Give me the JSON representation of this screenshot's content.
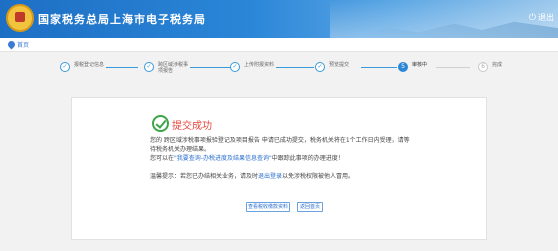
{
  "header": {
    "title": "国家税务总局上海市电子税务局",
    "logout_label": "退出"
  },
  "breadcrumb": {
    "home_label": "首页"
  },
  "steps": [
    {
      "index": "✓",
      "label": "报税登记信息",
      "state": "done"
    },
    {
      "index": "✓",
      "label": "跨区域涉税事项报告",
      "state": "done"
    },
    {
      "index": "✓",
      "label": "上传附报资料",
      "state": "done"
    },
    {
      "index": "✓",
      "label": "预览提交",
      "state": "done"
    },
    {
      "index": "5",
      "label": "审核中",
      "state": "current"
    },
    {
      "index": "6",
      "label": "完成",
      "state": "todo"
    }
  ],
  "result": {
    "title": "提交成功",
    "msg1_prefix": "您的 跨区域涉税事项报验登记及项目报告 申请已成功提交，税务机关将在1个工作日内受理，请等待税务机关办理结果。",
    "msg2_prefix": "您可以在",
    "msg2_link": "\"我要查询-办税进度及结果信息查询\"",
    "msg2_suffix": "中跟踪此事项的办理进度！",
    "msg3_prefix": "温馨提示：若您已办结相关业务，请及时",
    "msg3_link": "退出登录",
    "msg3_suffix": "以免涉税权限被他人冒用。"
  },
  "buttons": {
    "view_docs": "查看税收缴款资料",
    "back": "返回首页"
  },
  "colors": {
    "header_blue": "#2b86d8",
    "success_green": "#3ca54a",
    "success_red": "#e4483e",
    "link_blue": "#2b6fcf"
  }
}
